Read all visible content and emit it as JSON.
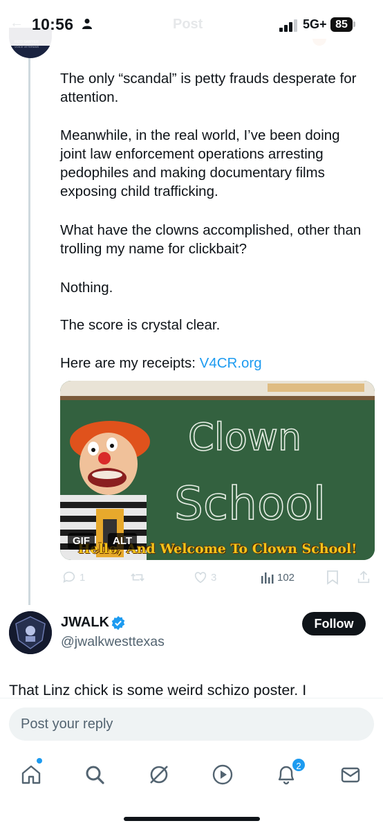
{
  "status_bar": {
    "time": "10:56",
    "network": "5G+",
    "battery": "85",
    "faded_title": "Post"
  },
  "tweet": {
    "paragraphs": [
      "The only “scandal” is petty frauds desperate for attention.",
      "Meanwhile, in the real world, I’ve been doing joint law enforcement operations arresting pedophiles and making documentary films exposing child trafficking.",
      "What have the clowns accomplished, other than trolling my name for clickbait?",
      "Nothing.",
      "The score is crystal clear."
    ],
    "receipts_prefix": "Here are my receipts: ",
    "receipts_link": "V4CR.org",
    "media": {
      "board_line1": "Clown",
      "board_line2": "School",
      "caption": "Hello, And Welcome To Clown School!",
      "gif_badge": "GIF",
      "alt_badge": "ALT"
    },
    "actions": {
      "replies": "1",
      "likes": "3",
      "views": "102"
    }
  },
  "reply_tweet": {
    "name": "JWALK",
    "handle": "@jwalkwesttexas",
    "follow_label": "Follow",
    "text": "That Linz chick is some weird schizo poster. I"
  },
  "composer": {
    "placeholder": "Post your reply"
  },
  "nav": {
    "notifications_count": "2",
    "icons": [
      "home-icon",
      "search-icon",
      "grok-icon",
      "video-icon",
      "notifications-icon",
      "messages-icon"
    ]
  },
  "colors": {
    "accent": "#1d9bf0",
    "text": "#0f1419",
    "secondary": "#536471",
    "chalkboard": "#2f5a3e"
  }
}
